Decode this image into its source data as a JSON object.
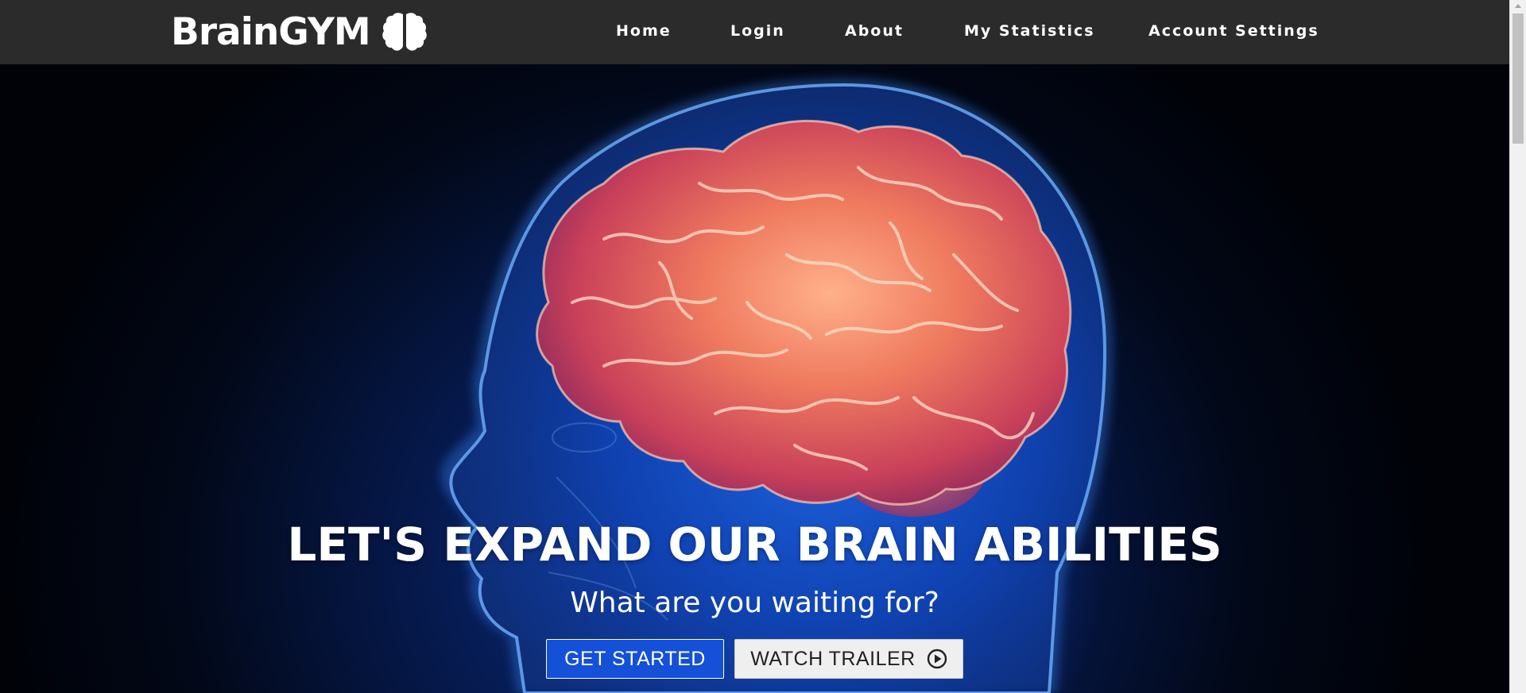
{
  "brand": {
    "name": "BrainGYM",
    "icon": "brain-icon"
  },
  "nav": {
    "items": [
      {
        "label": "Home"
      },
      {
        "label": "Login"
      },
      {
        "label": "About"
      },
      {
        "label": "My Statistics"
      },
      {
        "label": "Account Settings"
      }
    ]
  },
  "hero": {
    "title": "LET'S EXPAND OUR BRAIN ABILITIES",
    "subtitle": "What are you waiting for?",
    "primary_button": "GET STARTED",
    "secondary_button": "WATCH TRAILER",
    "secondary_icon": "play-circle-icon"
  },
  "colors": {
    "navbar_bg": "#2b2b2b",
    "primary_button_bg": "#1550d8",
    "secondary_button_bg": "#efefef",
    "hero_glow": "#2878ff",
    "brain_color": "#e8735a"
  }
}
